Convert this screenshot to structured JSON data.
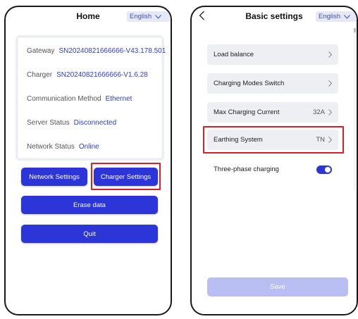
{
  "left_screen": {
    "title": "Home",
    "language": "English",
    "info": [
      {
        "label": "Gateway",
        "value": "SN20240821666666-V43.178.501"
      },
      {
        "label": "Charger",
        "value": "SN20240821666666-V1.6.28"
      },
      {
        "label": "Communication Method",
        "value": "Ethernet"
      },
      {
        "label": "Server Status",
        "value": "Disconnected"
      },
      {
        "label": "Network Status",
        "value": "Online"
      }
    ],
    "buttons": {
      "network_settings": "Network Settings",
      "charger_settings": "Charger Settings",
      "erase_data": "Erase data",
      "quit": "Quit"
    }
  },
  "right_screen": {
    "title": "Basic settings",
    "language": "English",
    "settings": [
      {
        "label": "Load balance",
        "value": ""
      },
      {
        "label": "Charging Modes Switch",
        "value": ""
      },
      {
        "label": "Max Charging Current",
        "value": "32A"
      },
      {
        "label": "Earthing System",
        "value": "TN"
      },
      {
        "label": "Three-phase charging",
        "toggle_on": true
      }
    ],
    "save_label": "Save"
  },
  "colors": {
    "accent": "#2b35d8",
    "highlight": "#d81f2a",
    "link": "#2c3fc4",
    "save_disabled": "#b9bff3"
  }
}
